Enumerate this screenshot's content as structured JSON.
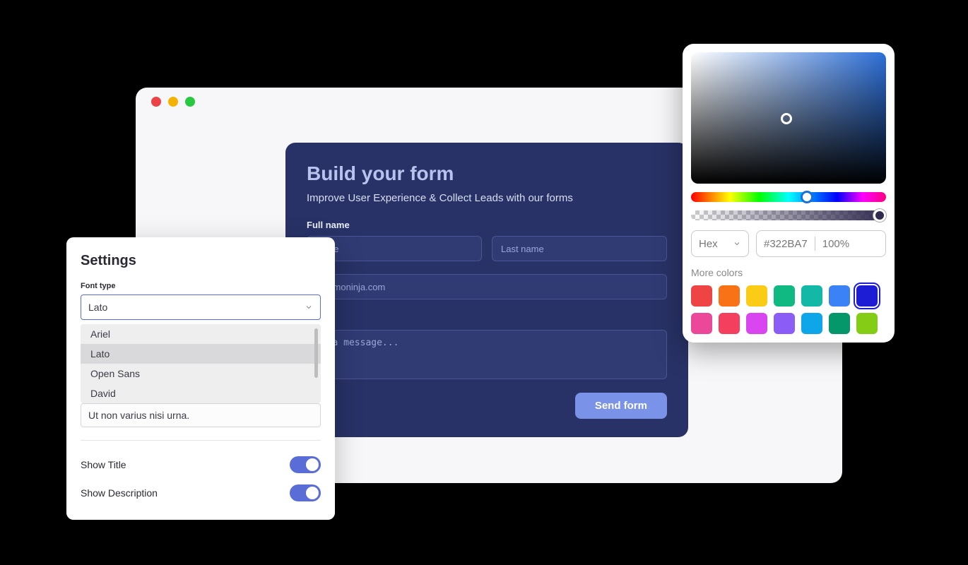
{
  "browser": {
    "traffic_colors": [
      "#ed4245",
      "#f5b301",
      "#27c940"
    ]
  },
  "form": {
    "title": "Build your form",
    "subtitle": "Improve User Experience & Collect Leads with our forms",
    "fullname_label": "Full name",
    "first_name_placeholder": "name",
    "last_name_placeholder": "Last name",
    "email_placeholder": "commoninja.com",
    "message_placeholder": "us a message...",
    "submit_label": "Send form"
  },
  "settings": {
    "title": "Settings",
    "font_type_label": "Font type",
    "font_type_value": "Lato",
    "font_options": [
      "Ariel",
      "Lato",
      "Open Sans",
      "David"
    ],
    "description_value": "Ut non varius nisi urna.",
    "show_title_label": "Show Title",
    "show_title_value": true,
    "show_description_label": "Show Description",
    "show_description_value": true
  },
  "color_picker": {
    "format": "Hex",
    "hex_value": "#322BA7",
    "opacity": "100%",
    "more_colors_label": "More colors",
    "swatches": [
      "#ef4444",
      "#f97316",
      "#facc15",
      "#10b981",
      "#14b8a6",
      "#3b82f6",
      "#1d1dd6",
      "#ec4899",
      "#f43f5e",
      "#d946ef",
      "#8b5cf6",
      "#0ea5e9",
      "#059669",
      "#84cc16"
    ],
    "selected_swatch_index": 6
  }
}
